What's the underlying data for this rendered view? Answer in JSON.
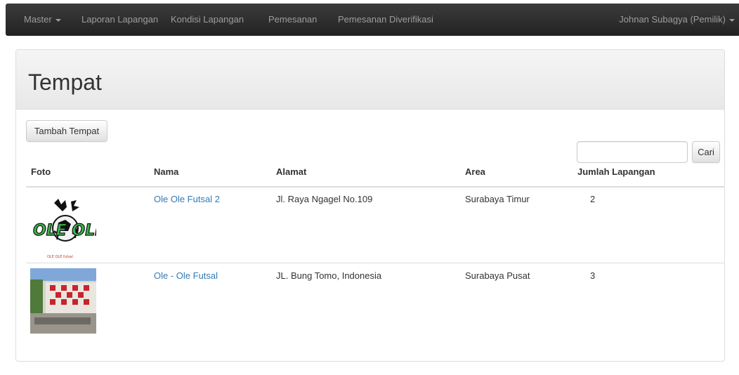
{
  "navbar": {
    "master": "Master",
    "items": [
      "Laporan Lapangan",
      "Kondisi Lapangan",
      "Pemesanan",
      "Pemesanan Diverifikasi"
    ],
    "user": "Johnan Subagya (Pemilik)"
  },
  "page": {
    "title": "Tempat"
  },
  "toolbar": {
    "add_label": "Tambah Tempat",
    "search_placeholder": "",
    "search_label": "Cari"
  },
  "table": {
    "headers": [
      "Foto",
      "Nama",
      "Alamat",
      "Area",
      "Jumlah Lapangan"
    ],
    "rows": [
      {
        "nama": "Ole Ole Futsal 2",
        "alamat": "Jl. Raya Ngagel No.109",
        "area": "Surabaya Timur",
        "jumlah": "2",
        "foto_text": "OLE OLE",
        "foto_caption": "OLE OLE futsal"
      },
      {
        "nama": "Ole - Ole Futsal",
        "alamat": "JL. Bung Tomo, Indonesia",
        "area": "Surabaya Pusat",
        "jumlah": "3"
      }
    ]
  },
  "colors": {
    "navbar": "#222222",
    "link": "#337ab7",
    "logo_green": "#39b54a"
  }
}
